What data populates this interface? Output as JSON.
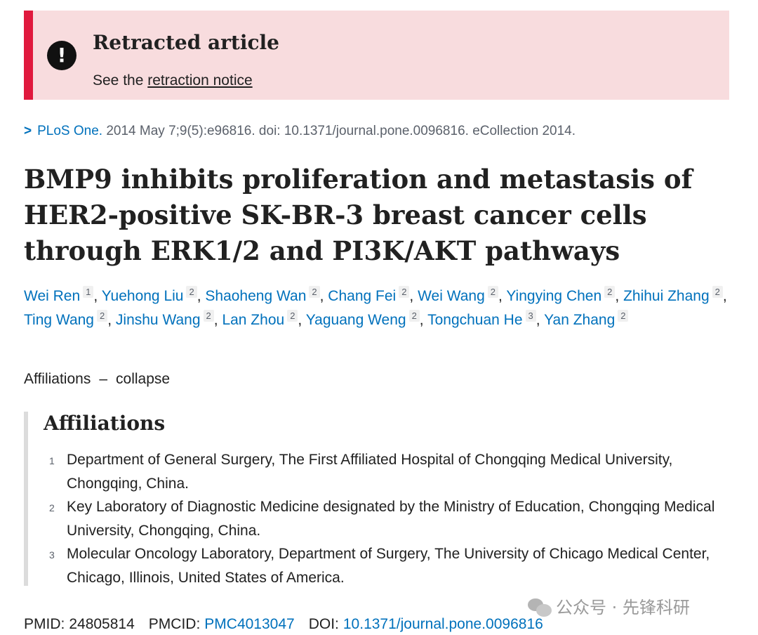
{
  "banner": {
    "icon": "exclamation-icon",
    "title": "Retracted article",
    "sub_prefix": "See the",
    "sub_link": "retraction notice",
    "accent_color": "#e0193d",
    "background_color": "#f8dcde"
  },
  "citation": {
    "journal": "PLoS One.",
    "details": "2014 May 7;9(5):e96816. doi: 10.1371/journal.pone.0096816. eCollection 2014."
  },
  "title": "BMP9 inhibits proliferation and metastasis of HER2-positive SK-BR-3 breast cancer cells through ERK1/2 and PI3K/AKT pathways",
  "authors": [
    {
      "name": "Wei Ren",
      "aff": "1"
    },
    {
      "name": "Yuehong Liu",
      "aff": "2"
    },
    {
      "name": "Shaoheng Wan",
      "aff": "2"
    },
    {
      "name": "Chang Fei",
      "aff": "2"
    },
    {
      "name": "Wei Wang",
      "aff": "2"
    },
    {
      "name": "Yingying Chen",
      "aff": "2"
    },
    {
      "name": "Zhihui Zhang",
      "aff": "2"
    },
    {
      "name": "Ting Wang",
      "aff": "2"
    },
    {
      "name": "Jinshu Wang",
      "aff": "2"
    },
    {
      "name": "Lan Zhou",
      "aff": "2"
    },
    {
      "name": "Yaguang Weng",
      "aff": "2"
    },
    {
      "name": "Tongchuan He",
      "aff": "3"
    },
    {
      "name": "Yan Zhang",
      "aff": "2"
    }
  ],
  "affiliations_toggle": {
    "label": "Affiliations",
    "action": "collapse"
  },
  "affiliations": {
    "heading": "Affiliations",
    "items": [
      {
        "num": "1",
        "text": "Department of General Surgery, The First Affiliated Hospital of Chongqing Medical University, Chongqing, China."
      },
      {
        "num": "2",
        "text": "Key Laboratory of Diagnostic Medicine designated by the Ministry of Education, Chongqing Medical University, Chongqing, China."
      },
      {
        "num": "3",
        "text": "Molecular Oncology Laboratory, Department of Surgery, The University of Chicago Medical Center, Chicago, Illinois, United States of America."
      }
    ]
  },
  "identifiers": {
    "pmid_label": "PMID:",
    "pmid": "24805814",
    "pmcid_label": "PMCID:",
    "pmcid": "PMC4013047",
    "doi_label": "DOI:",
    "doi": "10.1371/journal.pone.0096816"
  },
  "watermark": {
    "icon": "wechat-icon",
    "text": "公众号 · 先锋科研"
  },
  "colors": {
    "link": "#0071bc",
    "text": "#212121",
    "muted": "#5b616b"
  }
}
